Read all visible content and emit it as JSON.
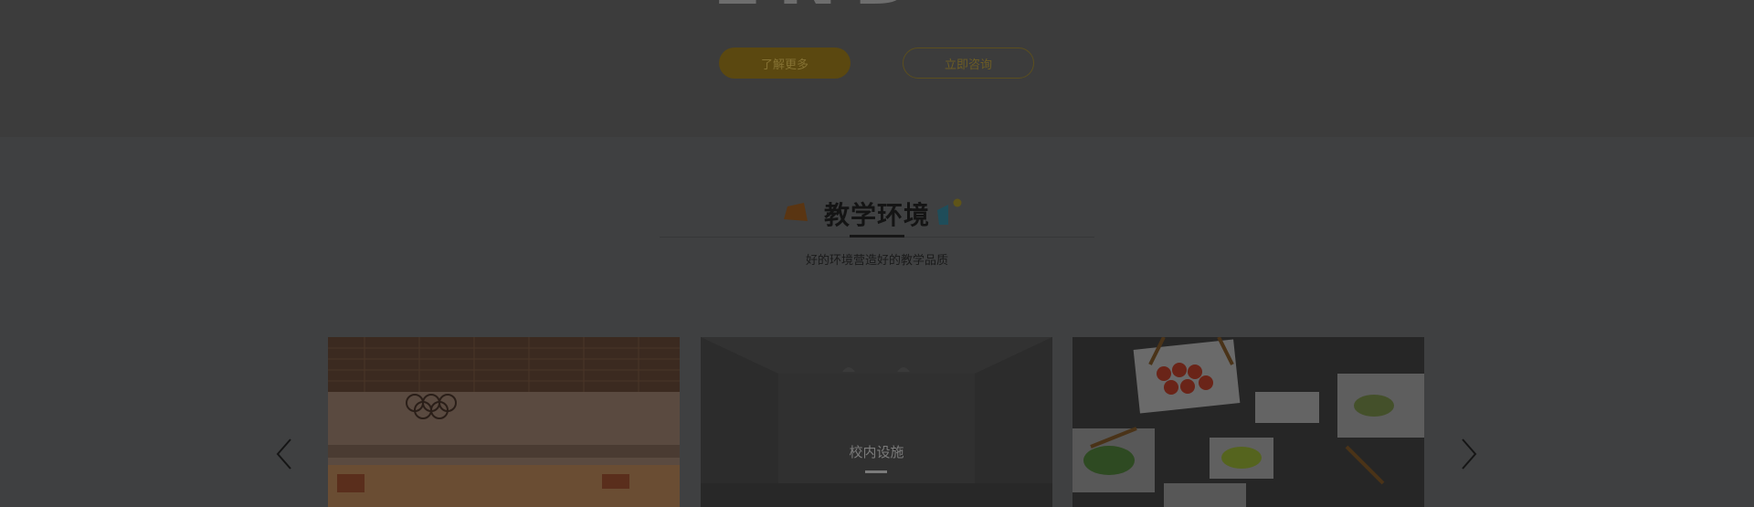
{
  "hero": {
    "title": "END",
    "btn_more": "了解更多",
    "btn_consult": "立即咨询"
  },
  "environment": {
    "title": "教学环境",
    "subtitle": "好的环境营造好的教学品质",
    "cards": [
      {
        "caption": ""
      },
      {
        "caption": "校内设施"
      },
      {
        "caption": ""
      }
    ]
  },
  "icons": {
    "prev": "chevron-left-icon",
    "next": "chevron-right-icon"
  },
  "colors": {
    "accent": "#5b4810",
    "page_overlay": "#3c3c3c"
  }
}
